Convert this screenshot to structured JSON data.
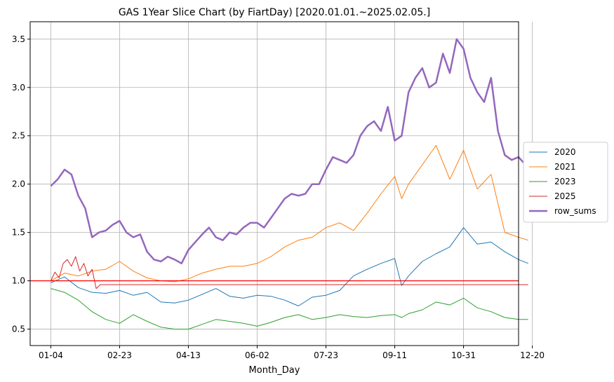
{
  "chart_data": {
    "type": "line",
    "title": "GAS 1Year Slice Chart (by FiartDay) [2020.01.01.~2025.02.05.]",
    "xlabel": "Month_Day",
    "ylabel": "",
    "x_ticks": [
      "01-04",
      "02-23",
      "04-13",
      "06-02",
      "07-23",
      "09-11",
      "10-31",
      "12-20"
    ],
    "x_tick_day_index": [
      0,
      50,
      100,
      150,
      200,
      250,
      300,
      350
    ],
    "xlim_day_index": [
      -15,
      340
    ],
    "ylim": [
      0.33,
      3.68
    ],
    "y_ticks": [
      "0.5",
      "1.0",
      "1.5",
      "2.0",
      "2.5",
      "3.0",
      "3.5"
    ],
    "grid": true,
    "legend_position": "outside-right",
    "reference_line": {
      "y": 1.0,
      "color": "#ff0000"
    },
    "series": [
      {
        "name": "2020",
        "color": "#1f77b4",
        "width": 1.0,
        "x": [
          0,
          10,
          20,
          30,
          40,
          50,
          60,
          70,
          80,
          90,
          100,
          110,
          120,
          130,
          140,
          150,
          160,
          170,
          180,
          190,
          200,
          210,
          220,
          230,
          240,
          250,
          255,
          260,
          270,
          280,
          290,
          300,
          310,
          320,
          330,
          340,
          347
        ],
        "y": [
          0.98,
          1.04,
          0.93,
          0.88,
          0.87,
          0.9,
          0.85,
          0.88,
          0.78,
          0.77,
          0.8,
          0.86,
          0.92,
          0.84,
          0.82,
          0.85,
          0.84,
          0.8,
          0.74,
          0.83,
          0.85,
          0.9,
          1.05,
          1.12,
          1.18,
          1.23,
          0.95,
          1.05,
          1.2,
          1.28,
          1.35,
          1.55,
          1.38,
          1.4,
          1.3,
          1.22,
          1.18
        ]
      },
      {
        "name": "2021",
        "color": "#ff7f0e",
        "width": 1.0,
        "x": [
          0,
          10,
          20,
          30,
          40,
          50,
          60,
          70,
          80,
          90,
          100,
          110,
          120,
          130,
          140,
          150,
          160,
          170,
          180,
          190,
          200,
          210,
          220,
          230,
          240,
          250,
          255,
          260,
          270,
          280,
          290,
          300,
          310,
          320,
          330,
          340,
          347
        ],
        "y": [
          1.0,
          1.08,
          1.05,
          1.1,
          1.12,
          1.2,
          1.1,
          1.03,
          1.0,
          0.99,
          1.02,
          1.08,
          1.12,
          1.15,
          1.15,
          1.18,
          1.25,
          1.35,
          1.42,
          1.45,
          1.55,
          1.6,
          1.52,
          1.7,
          1.9,
          2.08,
          1.85,
          2.0,
          2.2,
          2.4,
          2.05,
          2.35,
          1.95,
          2.1,
          1.5,
          1.45,
          1.42
        ]
      },
      {
        "name": "2023",
        "color": "#2ca02c",
        "width": 1.0,
        "x": [
          0,
          10,
          20,
          30,
          40,
          50,
          60,
          70,
          80,
          90,
          100,
          110,
          120,
          130,
          140,
          150,
          160,
          170,
          180,
          190,
          200,
          210,
          220,
          230,
          240,
          250,
          255,
          260,
          270,
          280,
          290,
          300,
          310,
          320,
          330,
          340,
          347
        ],
        "y": [
          0.92,
          0.88,
          0.8,
          0.68,
          0.6,
          0.56,
          0.65,
          0.58,
          0.52,
          0.5,
          0.5,
          0.55,
          0.6,
          0.58,
          0.56,
          0.53,
          0.57,
          0.62,
          0.65,
          0.6,
          0.62,
          0.65,
          0.63,
          0.62,
          0.64,
          0.65,
          0.62,
          0.66,
          0.7,
          0.78,
          0.75,
          0.82,
          0.72,
          0.68,
          0.62,
          0.6,
          0.6
        ]
      },
      {
        "name": "2025",
        "color": "#d62728",
        "width": 1.0,
        "x": [
          0,
          3,
          6,
          9,
          12,
          15,
          18,
          21,
          24,
          27,
          30,
          33,
          36,
          347
        ],
        "y": [
          1.0,
          1.09,
          1.03,
          1.18,
          1.22,
          1.15,
          1.25,
          1.1,
          1.18,
          1.05,
          1.12,
          0.92,
          0.96,
          0.96
        ]
      },
      {
        "name": "row_sums",
        "color": "#9467bd",
        "width": 2.5,
        "x": [
          0,
          5,
          10,
          15,
          20,
          25,
          30,
          35,
          40,
          45,
          50,
          55,
          60,
          65,
          70,
          75,
          80,
          85,
          90,
          95,
          100,
          105,
          110,
          115,
          120,
          125,
          130,
          135,
          140,
          145,
          150,
          155,
          160,
          165,
          170,
          175,
          180,
          185,
          190,
          195,
          200,
          205,
          210,
          215,
          220,
          225,
          230,
          235,
          240,
          245,
          250,
          255,
          260,
          265,
          270,
          275,
          280,
          285,
          290,
          295,
          300,
          305,
          310,
          315,
          320,
          325,
          330,
          335,
          340,
          345,
          347
        ],
        "y": [
          1.98,
          2.05,
          2.15,
          2.1,
          1.88,
          1.75,
          1.45,
          1.5,
          1.52,
          1.58,
          1.62,
          1.5,
          1.45,
          1.48,
          1.3,
          1.22,
          1.2,
          1.25,
          1.22,
          1.18,
          1.32,
          1.4,
          1.48,
          1.55,
          1.45,
          1.42,
          1.5,
          1.48,
          1.55,
          1.6,
          1.6,
          1.55,
          1.65,
          1.75,
          1.85,
          1.9,
          1.88,
          1.9,
          2.0,
          2.0,
          2.15,
          2.28,
          2.25,
          2.22,
          2.3,
          2.5,
          2.6,
          2.65,
          2.55,
          2.8,
          2.45,
          2.5,
          2.95,
          3.1,
          3.2,
          3.0,
          3.05,
          3.35,
          3.15,
          3.5,
          3.4,
          3.1,
          2.95,
          2.85,
          3.1,
          2.55,
          2.3,
          2.25,
          2.28,
          2.2,
          2.2
        ]
      }
    ]
  }
}
